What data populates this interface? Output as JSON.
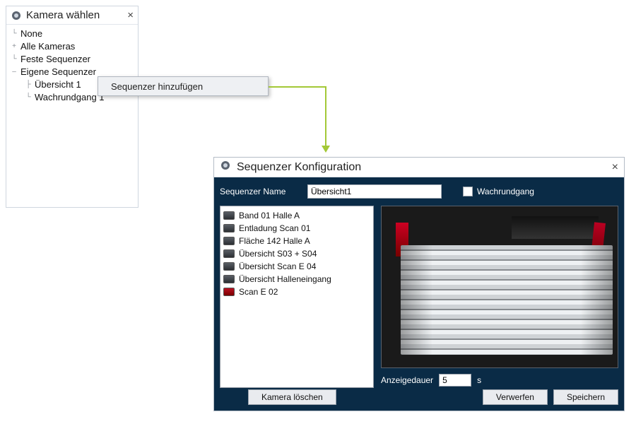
{
  "tree": {
    "title": "Kamera wählen",
    "items": [
      {
        "label": "None",
        "expand": ""
      },
      {
        "label": "Alle Kameras",
        "expand": "+"
      },
      {
        "label": "Feste Sequenzer",
        "expand": ""
      },
      {
        "label": "Eigene Sequenzer",
        "expand": "–",
        "highlight": true
      }
    ],
    "children": [
      {
        "label": "Übersicht 1"
      },
      {
        "label": "Wachrundgang 1"
      }
    ]
  },
  "context_menu": {
    "label": "Sequenzer hinzufügen"
  },
  "config": {
    "title": "Sequenzer Konfiguration",
    "name_label": "Sequenzer Name",
    "name_value": "Übersicht1",
    "patrol_label": "Wachrundgang",
    "cameras": [
      "Band 01 Halle A",
      "Entladung Scan 01",
      "Fläche 142 Halle A",
      "Übersicht S03 + S04",
      "Übersicht Scan E 04",
      "Übersicht Halleneingang",
      "Scan E 02"
    ],
    "duration_label": "Anzeigedauer",
    "duration_value": "5",
    "duration_unit": "s",
    "buttons": {
      "delete_camera": "Kamera löschen",
      "discard": "Verwerfen",
      "save": "Speichern"
    }
  }
}
